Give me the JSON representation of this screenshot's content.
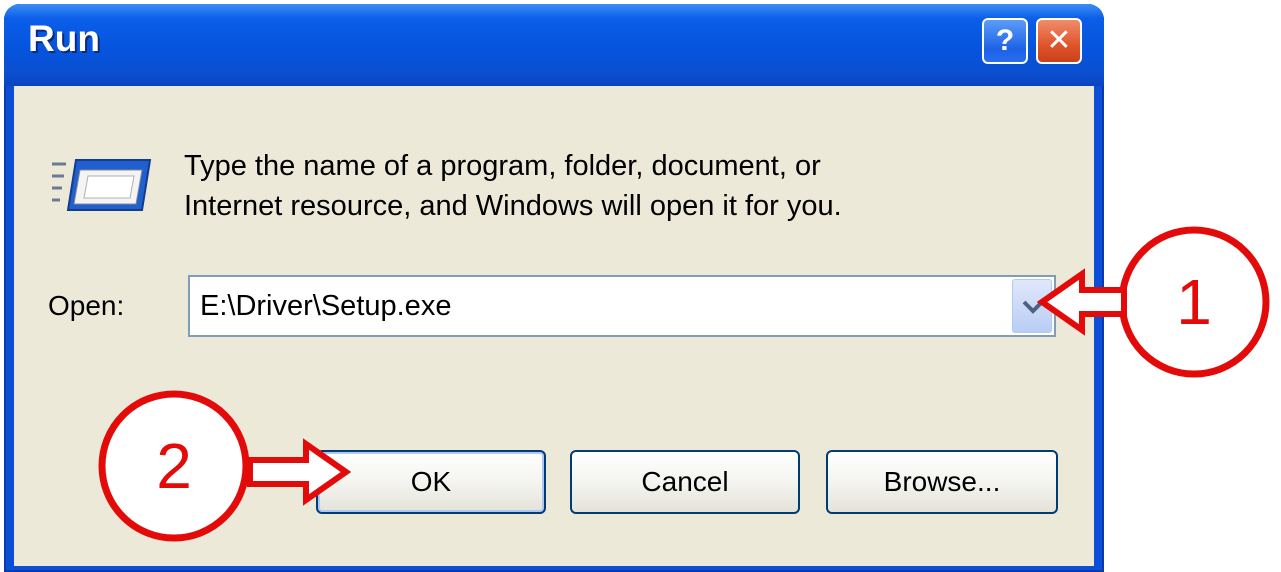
{
  "window": {
    "title": "Run",
    "help_label": "?",
    "close_label": "✕"
  },
  "dialog": {
    "description_line1": "Type the name of a program, folder, document, or",
    "description_line2": "Internet resource, and Windows will open it for you.",
    "open_label": "Open:",
    "open_value": "E:\\Driver\\Setup.exe"
  },
  "buttons": {
    "ok": "OK",
    "cancel": "Cancel",
    "browse": "Browse..."
  },
  "annotations": {
    "step1": "1",
    "step2": "2",
    "color": "#e30a0a"
  },
  "icons": {
    "run": "run-program-icon",
    "dropdown": "chevron-down-icon"
  },
  "colors": {
    "titlebar": "#0654de",
    "client_bg": "#ece9d8",
    "button_border": "#003c74"
  }
}
